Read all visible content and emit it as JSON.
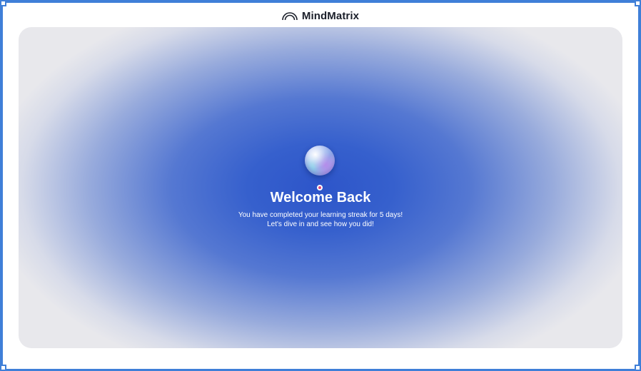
{
  "header": {
    "brand": "MindMatrix",
    "logo_icon": "rainbow-arc-icon"
  },
  "hero": {
    "title": "Welcome Back",
    "subtitle_line1": "You have completed your learning streak for 5 days!",
    "subtitle_line2": "Let's dive in and see how you did!",
    "orb_icon": "glass-orb-icon",
    "indicator_icon": "pink-dot-icon"
  },
  "colors": {
    "accent_blue": "#2d55c9",
    "frame_blue": "#3f7fd8",
    "indicator_pink": "#e0487a"
  }
}
